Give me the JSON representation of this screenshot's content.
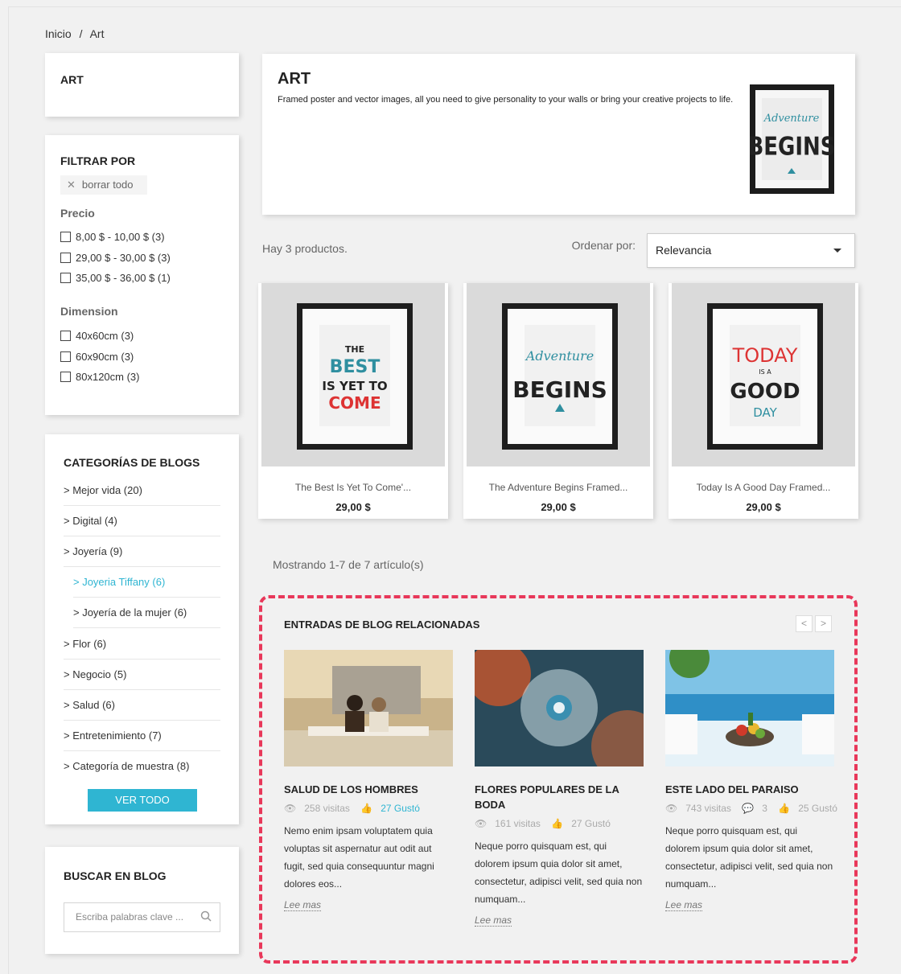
{
  "breadcrumb": {
    "home": "Inicio",
    "sep": "/",
    "current": "Art"
  },
  "sidebar": {
    "art_title": "ART",
    "filter": {
      "title": "FILTRAR POR",
      "clear_all": "borrar todo",
      "price_title": "Precio",
      "price_options": [
        "8,00 $ - 10,00 $ (3)",
        "29,00 $ - 30,00 $ (3)",
        "35,00 $ - 36,00 $ (1)"
      ],
      "dimension_title": "Dimension",
      "dimension_options": [
        "40x60cm (3)",
        "60x90cm (3)",
        "80x120cm (3)"
      ]
    },
    "blog_categories": {
      "title": "CATEGORÍAS DE BLOGS",
      "items": [
        "> Mejor vida (20)",
        "> Digital (4)",
        "> Joyería (9)",
        "> Joyeria Tiffany (6)",
        "> Joyería de la mujer (6)",
        "> Flor (6)",
        "> Negocio (5)",
        "> Salud (6)",
        "> Entretenimiento (7)",
        "> Categoría de muestra (8)"
      ],
      "view_all": "VER TODO"
    },
    "blog_search": {
      "title": "BUSCAR EN BLOG",
      "placeholder": "Escriba palabras clave ..."
    }
  },
  "category": {
    "title": "ART",
    "description": "Framed poster and vector images, all you need to give personality to your walls or bring your creative projects to life."
  },
  "listing": {
    "count_text": "Hay 3 productos.",
    "sort_label": "Ordenar por:",
    "sort_value": "Relevancia",
    "showing_text": "Mostrando 1-7 de 7 artículo(s)"
  },
  "products": [
    {
      "name": "The Best Is Yet To Come'...",
      "price": "29,00 $"
    },
    {
      "name": "The Adventure Begins Framed...",
      "price": "29,00 $"
    },
    {
      "name": "Today Is A Good Day Framed...",
      "price": "29,00 $"
    }
  ],
  "related": {
    "title": "ENTRADAS DE BLOG RELACIONADAS",
    "prev": "<",
    "next": ">",
    "read_more": "Lee mas",
    "posts": [
      {
        "title": "SALUD DE LOS HOMBRES",
        "views": "258 visitas",
        "comments": "",
        "likes": "27 Gustó",
        "excerpt": "Nemo enim ipsam voluptatem quia voluptas sit aspernatur aut odit aut fugit, sed quia consequuntur magni dolores eos..."
      },
      {
        "title": "FLORES POPULARES DE LA BODA",
        "views": "161 visitas",
        "comments": "",
        "likes": "27 Gustó",
        "excerpt": "Neque porro quisquam est, qui dolorem ipsum quia dolor sit amet, consectetur, adipisci velit, sed quia non numquam..."
      },
      {
        "title": "ESTE LADO DEL PARAISO",
        "views": "743 visitas",
        "comments": "3",
        "likes": "25 Gustó",
        "excerpt": "Neque porro quisquam est, qui dolorem ipsum quia dolor sit amet, consectetur, adipisci velit, sed quia non numquam..."
      }
    ]
  },
  "colors": {
    "accent": "#2fb5d2",
    "highlight_border": "#e8385a"
  }
}
